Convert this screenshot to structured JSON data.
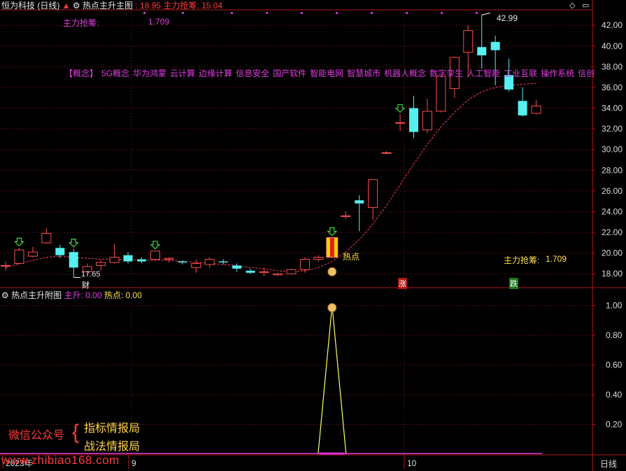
{
  "header": {
    "stock_name": "恒为科技 (日线)",
    "indicator_name": "热点主升主图",
    "value1": ": 18.95",
    "label2": "主力抢筹:",
    "value2": "15.04",
    "stock_icon": "red-up-arrow-icon",
    "indicator_icon": "gear-icon"
  },
  "main_chart": {
    "top_label": "主力抢筹:",
    "top_value": "1.709",
    "right_label": "主力抢筹:",
    "right_value": "1.709",
    "high_label": "42.99",
    "low_label": "17.65",
    "concept_tags": [
      "【概念】",
      "5G概念",
      "华为鸿蒙",
      "云计算",
      "边缘计算",
      "信息安全",
      "国产软件",
      "智能电网",
      "智慧城市",
      "机器人概念",
      "数字孪生",
      "人工智能",
      "工业互联",
      "操作系统",
      "信创"
    ],
    "hot_label": "热点",
    "marker_cai": "财",
    "marker_zhang": "涨",
    "marker_die": "跌",
    "y_axis_ticks": [
      "42.00",
      "40.00",
      "38.00",
      "36.00",
      "34.00",
      "32.00",
      "30.00",
      "28.00",
      "26.00",
      "24.00",
      "22.00",
      "20.00",
      "18.00"
    ],
    "colors": {
      "up": "#ff4d4d",
      "down": "#55f0f0",
      "ma": "#ff3b6b",
      "grid": "#8b1a1a"
    }
  },
  "sub_chart": {
    "title": "热点主升附图",
    "label1": "主升:",
    "value1": "0.00",
    "label2": "热点:",
    "value2": "0.00",
    "y_axis_ticks": [
      "1.00",
      "0.80",
      "0.60",
      "0.40",
      "0.20"
    ]
  },
  "chart_data": {
    "type": "candlestick",
    "title": "恒为科技 (日线)",
    "ylim": [
      16.8,
      43.5
    ],
    "candles": [
      {
        "o": 18.8,
        "h": 19.2,
        "l": 18.3,
        "c": 18.8
      },
      {
        "o": 19.0,
        "h": 20.5,
        "l": 18.9,
        "c": 20.3
      },
      {
        "o": 19.7,
        "h": 20.6,
        "l": 19.6,
        "c": 20.1
      },
      {
        "o": 21.0,
        "h": 22.4,
        "l": 20.9,
        "c": 21.9
      },
      {
        "o": 20.5,
        "h": 20.8,
        "l": 19.5,
        "c": 19.8
      },
      {
        "o": 20.1,
        "h": 20.4,
        "l": 17.65,
        "c": 18.6
      },
      {
        "o": 18.2,
        "h": 19.0,
        "l": 18.0,
        "c": 18.7
      },
      {
        "o": 18.8,
        "h": 19.3,
        "l": 18.3,
        "c": 19.1
      },
      {
        "o": 19.1,
        "h": 20.9,
        "l": 19.0,
        "c": 19.6
      },
      {
        "o": 19.8,
        "h": 20.1,
        "l": 19.0,
        "c": 19.2
      },
      {
        "o": 19.4,
        "h": 19.6,
        "l": 19.0,
        "c": 19.2
      },
      {
        "o": 19.4,
        "h": 20.2,
        "l": 19.3,
        "c": 20.2
      },
      {
        "o": 19.4,
        "h": 19.6,
        "l": 19.1,
        "c": 19.5
      },
      {
        "o": 19.2,
        "h": 19.3,
        "l": 18.9,
        "c": 19.1
      },
      {
        "o": 18.6,
        "h": 19.4,
        "l": 18.1,
        "c": 19.0
      },
      {
        "o": 18.9,
        "h": 19.6,
        "l": 18.6,
        "c": 19.4
      },
      {
        "o": 19.2,
        "h": 19.4,
        "l": 18.9,
        "c": 19.1
      },
      {
        "o": 18.8,
        "h": 19.0,
        "l": 18.2,
        "c": 18.5
      },
      {
        "o": 18.3,
        "h": 18.5,
        "l": 18.0,
        "c": 18.1
      },
      {
        "o": 18.2,
        "h": 18.6,
        "l": 17.8,
        "c": 18.2
      },
      {
        "o": 17.9,
        "h": 18.1,
        "l": 17.8,
        "c": 18.0
      },
      {
        "o": 18.0,
        "h": 18.5,
        "l": 17.9,
        "c": 18.4
      },
      {
        "o": 18.4,
        "h": 19.6,
        "l": 18.1,
        "c": 19.4
      },
      {
        "o": 19.4,
        "h": 19.8,
        "l": 19.2,
        "c": 19.6
      },
      {
        "o": 19.6,
        "h": 21.5,
        "l": 19.5,
        "c": 21.5
      },
      {
        "o": 23.6,
        "h": 24.0,
        "l": 23.3,
        "c": 23.6
      },
      {
        "o": 25.1,
        "h": 25.6,
        "l": 22.1,
        "c": 24.8
      },
      {
        "o": 24.4,
        "h": 27.1,
        "l": 23.2,
        "c": 27.1
      },
      {
        "o": 29.7,
        "h": 29.8,
        "l": 29.6,
        "c": 29.7
      },
      {
        "o": 32.6,
        "h": 33.4,
        "l": 31.8,
        "c": 32.6
      },
      {
        "o": 34.0,
        "h": 35.2,
        "l": 31.1,
        "c": 31.7
      },
      {
        "o": 31.9,
        "h": 34.9,
        "l": 31.6,
        "c": 33.7
      },
      {
        "o": 33.7,
        "h": 37.1,
        "l": 33.6,
        "c": 37.1
      },
      {
        "o": 35.9,
        "h": 39.0,
        "l": 35.0,
        "c": 38.9
      },
      {
        "o": 39.4,
        "h": 42.0,
        "l": 37.0,
        "c": 41.5
      },
      {
        "o": 39.9,
        "h": 42.99,
        "l": 37.8,
        "c": 39.1
      },
      {
        "o": 40.4,
        "h": 41.0,
        "l": 36.2,
        "c": 39.6
      },
      {
        "o": 37.2,
        "h": 38.8,
        "l": 35.6,
        "c": 35.8
      },
      {
        "o": 34.7,
        "h": 36.0,
        "l": 33.2,
        "c": 33.3
      },
      {
        "o": 33.5,
        "h": 34.8,
        "l": 33.4,
        "c": 34.2
      }
    ],
    "ma_line": [
      18.6,
      19.0,
      19.3,
      19.6,
      19.7,
      19.6,
      19.5,
      19.4,
      19.4,
      19.4,
      19.3,
      19.3,
      19.3,
      19.2,
      19.1,
      19.0,
      18.9,
      18.8,
      18.6,
      18.5,
      18.3,
      18.2,
      18.3,
      18.6,
      19.2,
      20.1,
      21.3,
      22.8,
      24.6,
      26.6,
      28.6,
      30.5,
      32.2,
      33.6,
      34.8,
      35.6,
      36.0,
      36.2,
      36.3,
      36.4
    ],
    "sub_series": [
      {
        "name": "热点",
        "values": [
          0,
          0,
          0,
          0,
          0,
          0,
          0,
          0,
          0,
          0,
          0,
          0,
          0,
          0,
          0,
          0,
          0,
          0,
          0,
          0,
          0,
          0,
          0,
          0,
          1,
          0,
          0,
          0,
          0,
          0,
          0,
          0,
          0,
          0,
          0,
          0,
          0,
          0,
          0,
          0
        ]
      }
    ],
    "sub_ylim": [
      0,
      1.05
    ],
    "x_labels": [
      "2023年",
      "9",
      "10"
    ],
    "legend": [
      "主升",
      "热点"
    ]
  },
  "watermark": {
    "wechat": "微信公众号",
    "brand1": "指标情报局",
    "brand2": "战法情报局",
    "url": "www.zhibiao168.com"
  },
  "footer": {
    "period": "日线"
  }
}
